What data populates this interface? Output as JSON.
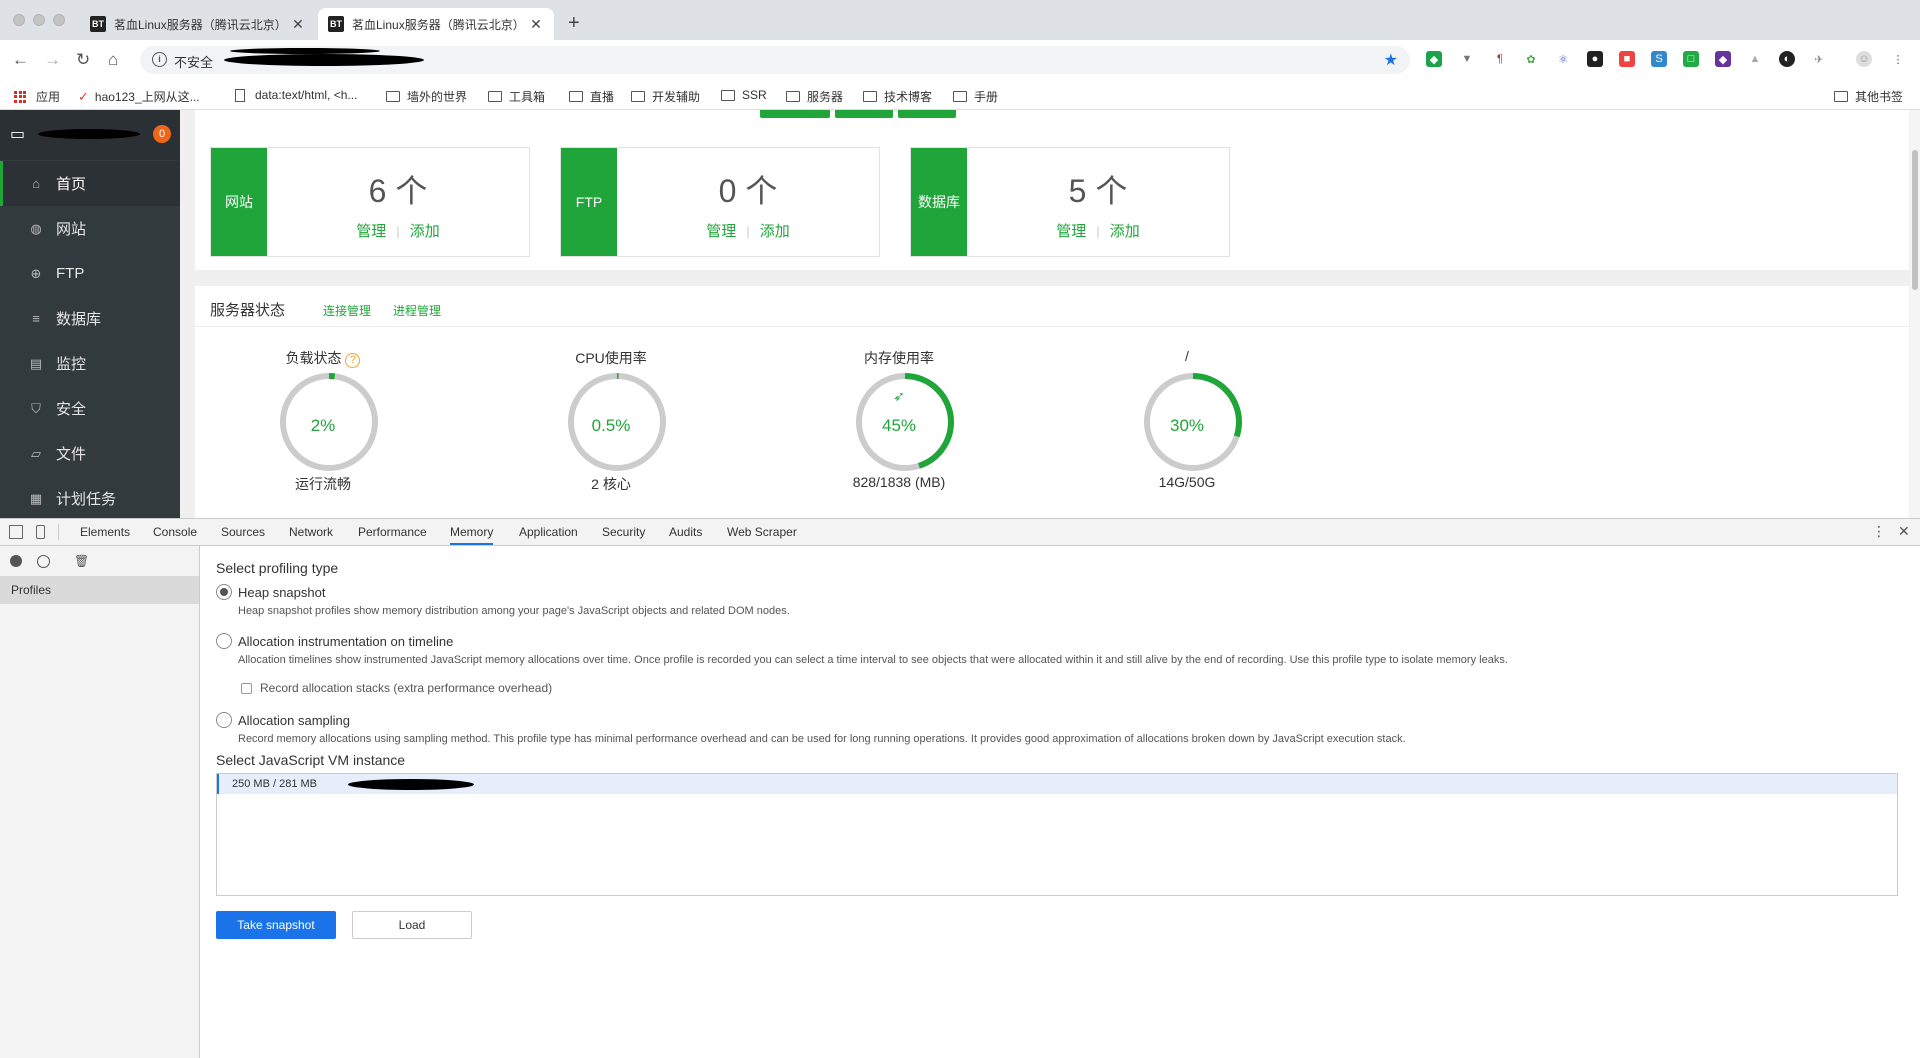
{
  "browser": {
    "tabs": [
      {
        "favicon": "BT",
        "title": "茗血Linux服务器（腾讯云北京）",
        "active": false
      },
      {
        "favicon": "BT",
        "title": "茗血Linux服务器（腾讯云北京）",
        "active": true
      }
    ],
    "new_tab": "+",
    "address": {
      "security_label": "不安全"
    },
    "bookmarks": [
      {
        "label": "应用",
        "icon": "apps-icon"
      },
      {
        "label": "hao123_上网从这...",
        "icon": "hao123-icon"
      },
      {
        "label": "data:text/html, <h...",
        "icon": "page-icon"
      },
      {
        "label": "墙外的世界",
        "icon": "folder-icon"
      },
      {
        "label": "工具箱",
        "icon": "folder-icon"
      },
      {
        "label": "直播",
        "icon": "folder-icon"
      },
      {
        "label": "开发辅助",
        "icon": "folder-icon"
      },
      {
        "label": "SSR",
        "icon": "folder-icon"
      },
      {
        "label": "服务器",
        "icon": "folder-icon"
      },
      {
        "label": "技术博客",
        "icon": "folder-icon"
      },
      {
        "label": "手册",
        "icon": "folder-icon"
      }
    ],
    "other_bookmarks": "其他书签"
  },
  "panel": {
    "notification_count": "0",
    "nav": [
      {
        "label": "首页",
        "icon": "home-icon",
        "active": true
      },
      {
        "label": "网站",
        "icon": "globe-icon",
        "active": false
      },
      {
        "label": "FTP",
        "icon": "ftp-icon",
        "active": false
      },
      {
        "label": "数据库",
        "icon": "database-icon",
        "active": false
      },
      {
        "label": "监控",
        "icon": "monitor-icon",
        "active": false
      },
      {
        "label": "安全",
        "icon": "shield-icon",
        "active": false
      },
      {
        "label": "文件",
        "icon": "folder-icon",
        "active": false
      },
      {
        "label": "计划任务",
        "icon": "calendar-icon",
        "active": false
      }
    ],
    "cards": [
      {
        "label": "网站",
        "count": "6 个",
        "manage": "管理",
        "add": "添加"
      },
      {
        "label": "FTP",
        "count": "0 个",
        "manage": "管理",
        "add": "添加"
      },
      {
        "label": "数据库",
        "count": "5 个",
        "manage": "管理",
        "add": "添加"
      }
    ],
    "status": {
      "title": "服务器状态",
      "links": [
        "连接管理",
        "进程管理"
      ],
      "gauges": [
        {
          "title": "负载状态",
          "value": "2%",
          "percent": 2,
          "caption": "运行流畅",
          "help": "?"
        },
        {
          "title": "CPU使用率",
          "value": "0.5%",
          "percent": 0.5,
          "caption": "2 核心"
        },
        {
          "title": "内存使用率",
          "value": "45%",
          "percent": 45,
          "caption": "828/1838 (MB)",
          "icon": "rocket-icon"
        },
        {
          "title": "/",
          "value": "30%",
          "percent": 30,
          "caption": "14G/50G"
        }
      ]
    }
  },
  "devtools": {
    "tabs": [
      "Elements",
      "Console",
      "Sources",
      "Network",
      "Performance",
      "Memory",
      "Application",
      "Security",
      "Audits",
      "Web Scraper"
    ],
    "active_tab": "Memory",
    "sidebar_label": "Profiles",
    "select_profiling_type": "Select profiling type",
    "options": [
      {
        "label": "Heap snapshot",
        "checked": true,
        "description": "Heap snapshot profiles show memory distribution among your page's JavaScript objects and related DOM nodes."
      },
      {
        "label": "Allocation instrumentation on timeline",
        "checked": false,
        "description": "Allocation timelines show instrumented JavaScript memory allocations over time. Once profile is recorded you can select a time interval to see objects that were allocated within it and still alive by the end of recording. Use this profile type to isolate memory leaks."
      },
      {
        "label": "Allocation sampling",
        "checked": false,
        "description": "Record memory allocations using sampling method. This profile type has minimal performance overhead and can be used for long running operations. It provides good approximation of allocations broken down by JavaScript execution stack."
      }
    ],
    "record_stacks": "Record allocation stacks (extra performance overhead)",
    "select_vm": "Select JavaScript VM instance",
    "vm_instance": "250 MB / 281 MB",
    "take_snapshot": "Take snapshot",
    "load": "Load"
  },
  "colors": {
    "accent_green": "#20a53a",
    "devtools_blue": "#1a73e8",
    "badge_orange": "#f0671a"
  }
}
